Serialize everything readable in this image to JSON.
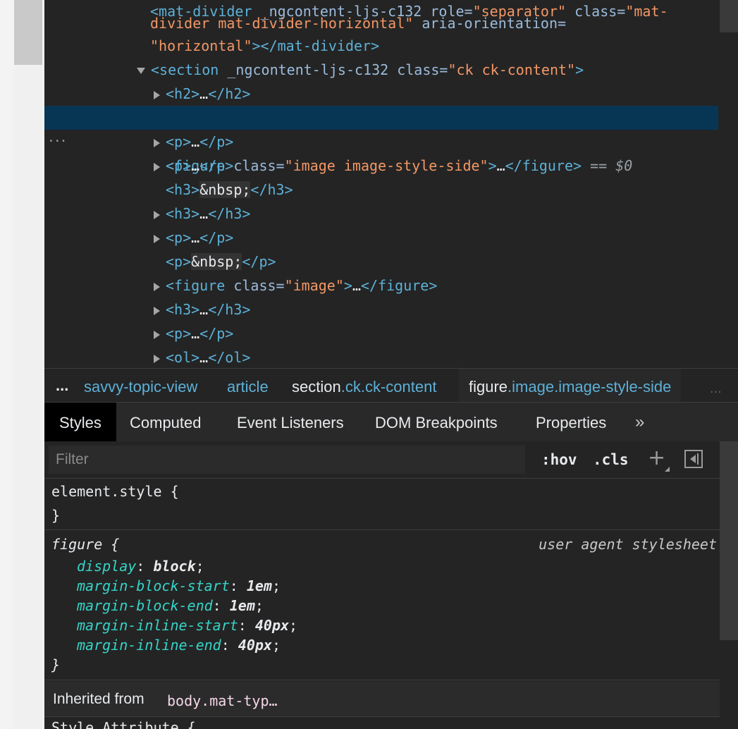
{
  "dom_tree": {
    "line0": {
      "indent": "  ",
      "tag_open": "<mat-divider",
      "attr1_name": " _ngcontent-ljs-c132",
      "attr2_name": " role=",
      "attr2_value": "\"separator\"",
      "attr3_name": " class=",
      "attr3_value": "\"mat-"
    },
    "line1": {
      "indent": "  ",
      "attr_value_cont": "divider mat-divider-horizontal\"",
      "attr_name": " aria-orientation="
    },
    "line2": {
      "indent": "  ",
      "attr_value": "\"horizontal\"",
      "tag_rest": "></mat-divider>"
    },
    "line3": {
      "tag_open": "<section",
      "attr1_name": " _ngcontent-ljs-c132",
      "attr2_name": " class=",
      "attr2_value": "\"ck ck-content\"",
      "tag_close": ">"
    },
    "line4": {
      "open": "<h2>",
      "ellipsis": "…",
      "close": "</h2>"
    },
    "line5": {
      "tag_open": "<figure",
      "attr_name": " class=",
      "attr_value": "\"image image-style-side\"",
      "tag_mid": ">",
      "ellipsis": "…",
      "close": "</figure>",
      "eq": " == ",
      "dollar": "$0"
    },
    "line6": {
      "open": "<p>",
      "ellipsis": "…",
      "close": "</p>"
    },
    "line7": {
      "open": "<p>",
      "ellipsis": "…",
      "close": "</p>"
    },
    "line8": {
      "open": "<h3>",
      "entity": "&nbsp;",
      "close": "</h3>"
    },
    "line9": {
      "open": "<h3>",
      "ellipsis": "…",
      "close": "</h3>"
    },
    "line10": {
      "open": "<p>",
      "ellipsis": "…",
      "close": "</p>"
    },
    "line11": {
      "open": "<p>",
      "entity": "&nbsp;",
      "close": "</p>"
    },
    "line12": {
      "tag_open": "<figure",
      "attr_name": " class=",
      "attr_value": "\"image\"",
      "tag_mid": ">",
      "ellipsis": "…",
      "close": "</figure>"
    },
    "line13": {
      "open": "<h3>",
      "ellipsis": "…",
      "close": "</h3>"
    },
    "line14": {
      "open": "<p>",
      "ellipsis": "…",
      "close": "</p>"
    },
    "line15": {
      "open": "<ol>",
      "ellipsis": "…",
      "close": "</ol>"
    },
    "selected_dots": "···"
  },
  "breadcrumb": {
    "more_left": "...",
    "items": [
      {
        "label": "savvy-topic-view"
      },
      {
        "label": "article"
      },
      {
        "tag": "section",
        "cls": ".ck.ck-content"
      },
      {
        "tag": "figure",
        "cls": ".image.image-style-side"
      }
    ],
    "more_right": "..."
  },
  "tabs": {
    "items": [
      "Styles",
      "Computed",
      "Event Listeners",
      "DOM Breakpoints",
      "Properties"
    ],
    "active": "Styles",
    "more": "»"
  },
  "filter": {
    "placeholder": "Filter",
    "hov_label": ":hov",
    "cls_label": ".cls",
    "plus_label": "+"
  },
  "styles": {
    "element_style": {
      "selector": "element.style {",
      "close": "}"
    },
    "figure_rule": {
      "selector": "figure",
      "open": " {",
      "source": "user agent stylesheet",
      "declarations": [
        {
          "prop": "display",
          "value": "block"
        },
        {
          "prop": "margin-block-start",
          "value": "1em"
        },
        {
          "prop": "margin-block-end",
          "value": "1em"
        },
        {
          "prop": "margin-inline-start",
          "value": "40px"
        },
        {
          "prop": "margin-inline-end",
          "value": "40px"
        }
      ],
      "close": "}"
    },
    "inherited_label": "Inherited from",
    "inherited_selector": "body.mat-typ…",
    "style_attribute": "Style Attribute {"
  },
  "colors": {
    "selected_row": "#073655",
    "tag": "#5db0d7",
    "attr_value": "#f29766",
    "css_prop": "#35d4c7"
  }
}
